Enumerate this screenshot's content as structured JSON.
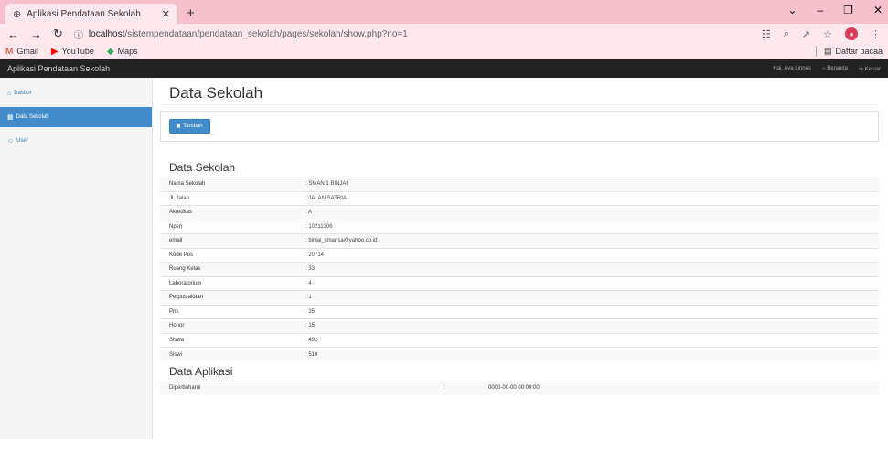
{
  "browser": {
    "tab_title": "Aplikasi Pendataan Sekolah",
    "url_host": "localhost",
    "url_path": "/sistempendataan/pendataan_sekolah/pages/sekolah/show.php?no=1",
    "bookmarks": [
      "Gmail",
      "YouTube",
      "Maps"
    ],
    "reading_list": "Daftar bacaa"
  },
  "app": {
    "brand": "Aplikasi Pendataan Sekolah",
    "nav": [
      "Hai, Ava Linnes",
      "Beranda",
      "Keluar"
    ]
  },
  "sidebar": {
    "items": [
      {
        "label": "Dasbor",
        "icon": "home-icon"
      },
      {
        "label": "Data Sekolah",
        "icon": "table-icon"
      },
      {
        "label": "User",
        "icon": "user-icon"
      }
    ]
  },
  "main": {
    "page_title": "Data Sekolah",
    "add_button": "Tambah",
    "detail_title": "Data Sekolah",
    "rows": [
      {
        "key": "Nama Sekolah",
        "value": ": SMAN 1 BINJAI"
      },
      {
        "key": "Jl. Jalan",
        "value": ": JALAN SATRIA"
      },
      {
        "key": "Akreditas",
        "value": ": A"
      },
      {
        "key": "Npsn",
        "value": ": 10211306"
      },
      {
        "key": "email",
        "value": ": binjai_smansa@yahoo.co.id"
      },
      {
        "key": "Kode Pos",
        "value": ": 20714"
      },
      {
        "key": "Ruang Kelas",
        "value": ": 33"
      },
      {
        "key": "Laboratorium",
        "value": ": 4"
      },
      {
        "key": "Perpustakaan",
        "value": ": 1"
      },
      {
        "key": "Pns",
        "value": ": 35"
      },
      {
        "key": "Honor",
        "value": ": 15"
      },
      {
        "key": "Siswa",
        "value": ": 492"
      },
      {
        "key": "Siswi",
        "value": ": 510"
      }
    ],
    "app_title": "Data Aplikasi",
    "app_rows": [
      {
        "key": "Diperbaharui",
        "colon": ":",
        "value": "0000-00-00 00:00:00"
      }
    ]
  }
}
